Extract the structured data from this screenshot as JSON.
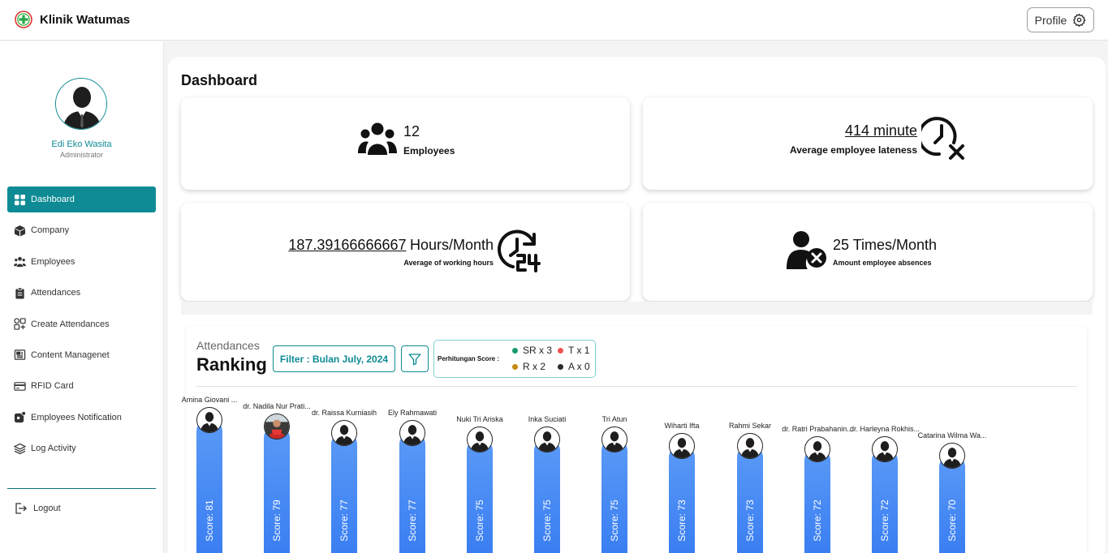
{
  "app": {
    "name": "Klinik Watumas",
    "profile_label": "Profile"
  },
  "user": {
    "name": "Edi Eko Wasita",
    "role": "Administrator"
  },
  "menu": [
    {
      "label": "Dashboard",
      "icon": "grid-icon",
      "active": true
    },
    {
      "label": "Company",
      "icon": "box-icon"
    },
    {
      "label": "Employees",
      "icon": "users-icon"
    },
    {
      "label": "Attendances",
      "icon": "clipboard-icon"
    },
    {
      "label": "Create Attendances",
      "icon": "shapes-icon"
    },
    {
      "label": "Content Managenet",
      "icon": "newspaper-icon"
    },
    {
      "label": "RFID Card",
      "icon": "card-icon"
    },
    {
      "label": "Employees Notification",
      "icon": "notification-icon"
    },
    {
      "label": "Log Activity",
      "icon": "layers-icon"
    }
  ],
  "logout_label": "Logout",
  "page_title": "Dashboard",
  "stats": {
    "employees": {
      "value": "12",
      "label": "Employees"
    },
    "lateness": {
      "value": "414 minute",
      "label": "Average employee lateness"
    },
    "working": {
      "value": "187.39166666667",
      "unit": "Hours/Month",
      "label": "Average of working hours"
    },
    "absences": {
      "value": "25 Times/Month",
      "label": "Amount employee absences"
    }
  },
  "ranking": {
    "subtitle": "Attendances",
    "title": "Ranking",
    "filter_label": "Filter : Bulan July, 2024",
    "score_label": "Perhitungan Score :",
    "legend": [
      {
        "label": "SR x 3",
        "color": "#159a6e"
      },
      {
        "label": "T x 1",
        "color": "#ef5350"
      },
      {
        "label": "R x 2",
        "color": "#c58a12"
      },
      {
        "label": "A x 0",
        "color": "#2b2b2b"
      }
    ],
    "score_prefix": "Score: ",
    "employees": [
      {
        "name": "Amina Giovani ...",
        "score": 81
      },
      {
        "name": "dr. Nadila Nur Prati...",
        "score": 79,
        "photo": true
      },
      {
        "name": "dr. Raissa Kurniasih",
        "score": 77
      },
      {
        "name": "Ely Rahmawati",
        "score": 77
      },
      {
        "name": "Nuki Tri Ariska",
        "score": 75
      },
      {
        "name": "Inka Suciati",
        "score": 75
      },
      {
        "name": "Tri Atun",
        "score": 75
      },
      {
        "name": "Wiharti Ifta",
        "score": 73
      },
      {
        "name": "Rahmi Sekar",
        "score": 73
      },
      {
        "name": "dr. Ratri Prabahanin...",
        "score": 72
      },
      {
        "name": "dr. Harleyna Rokhis...",
        "score": 72
      },
      {
        "name": "Catarina Wilma Wa...",
        "score": 70
      }
    ]
  }
}
